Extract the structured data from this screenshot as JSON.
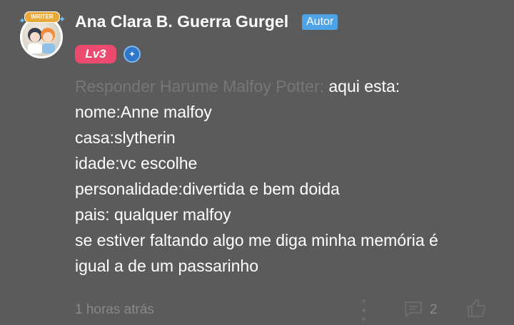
{
  "user": {
    "name": "Ana Clara B. Guerra Gurgel",
    "author_tag": "Autor",
    "level": "Lv3",
    "avatar_badge": "WRITER"
  },
  "comment": {
    "reply_prefix": "Responder Harume Malfoy Potter:",
    "first_line": "aqui esta:",
    "lines": [
      "nome:Anne malfoy",
      "casa:slytherin",
      "idade:vc escolhe",
      "personalidade:divertida e bem doida",
      "pais: qualquer malfoy",
      "se estiver faltando algo me diga minha memória é",
      "igual a de um passarinho"
    ]
  },
  "footer": {
    "timestamp": "1 horas atrás",
    "reply_count": "2"
  },
  "icons": {
    "more": "more-vertical-icon",
    "reply": "comment-icon",
    "like": "thumbs-up-icon",
    "shield": "shield-icon"
  },
  "colors": {
    "background": "#5b5b5b",
    "author_tag": "#4da3e6",
    "level_badge": "#ec4a6f",
    "muted_text": "#777777"
  }
}
